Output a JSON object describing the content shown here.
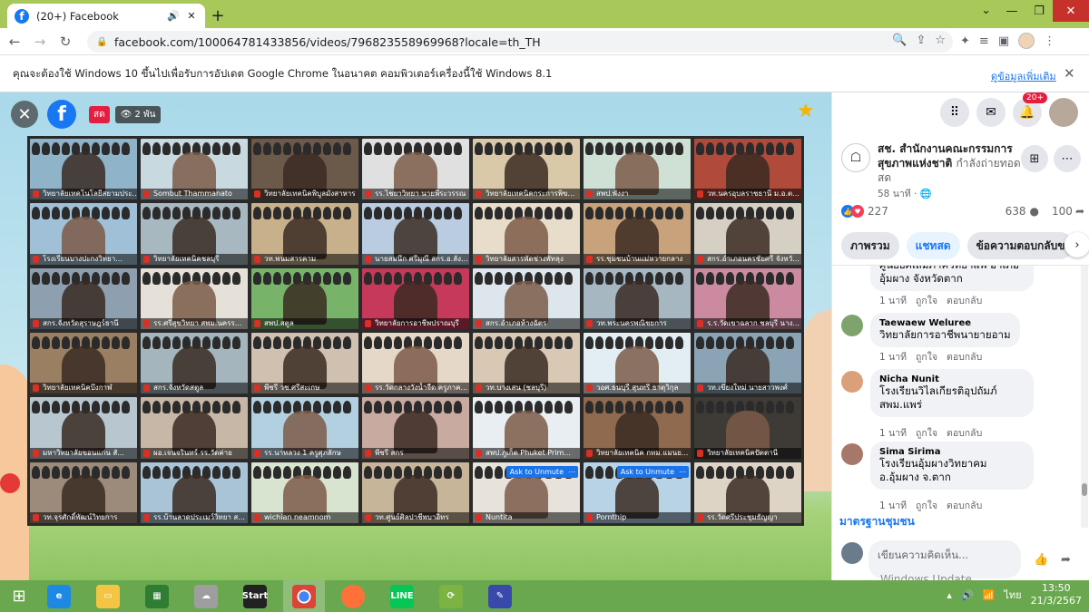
{
  "browser": {
    "tab_title": "(20+) Facebook",
    "url": "facebook.com/100064781433856/videos/796823558969968?locale=th_TH",
    "infobar_message": "คุณจะต้องใช้ Windows 10 ขึ้นไปเพื่อรับการอัปเดต Google Chrome ในอนาคต คอมพิวเตอร์เครื่องนี้ใช้ Windows 8.1",
    "infobar_link": "ดูข้อมูลเพิ่มเติม"
  },
  "video": {
    "live_label": "สด",
    "viewers": "2 พัน",
    "participants": [
      {
        "name": "วิทยาลัยเทคโนโลยีสยามประ...",
        "color": "#8fb3c9",
        "light": false
      },
      {
        "name": "Sombut Thammanato",
        "color": "#c9d9e0",
        "light": true
      },
      {
        "name": "วิทยาลัยเทคนิคพิบูลมังสาหาร",
        "color": "#6b5a4a",
        "light": false
      },
      {
        "name": "รร.ไชยาวิทยา นายพีระวรรณ",
        "color": "#e0e0e0",
        "light": true
      },
      {
        "name": "วิทยาลัยเทคนิคกระการพิข...",
        "color": "#d9c9a8",
        "light": false
      },
      {
        "name": "สพป.พังงา",
        "color": "#cfe0d4",
        "light": true
      },
      {
        "name": "วท.นครอุบลราชธานี ม.อ.ต...",
        "color": "#b04a3a",
        "light": false
      },
      {
        "name": "โรงเรียนบางปะกงวิทยา...",
        "color": "#9fc0d6",
        "light": true
      },
      {
        "name": "วิทยาลัยเทคนิคชลบุรี",
        "color": "#a8b8c0",
        "light": false
      },
      {
        "name": "วท.พนมสารคาม",
        "color": "#c8b08a",
        "light": false
      },
      {
        "name": "นายสมนึก ศรีมุณี สกร.อ.ลัง...",
        "color": "#b9cce0",
        "light": false
      },
      {
        "name": "วิทยาลัยสารพัดช่างพัทลุง",
        "color": "#e8dccb",
        "light": true
      },
      {
        "name": "รร.ชุมชนบ้านแม่หวายกลาง",
        "color": "#c7a27a",
        "light": false
      },
      {
        "name": "สกร.อำเภอนครชัยศรี จังหวั...",
        "color": "#d6d0c4",
        "light": false
      },
      {
        "name": "สกร.จังหวัดสุราษฎร์ธานี",
        "color": "#8e9fb0",
        "light": false
      },
      {
        "name": "รร.ศรีสุขวิทยา สพม.นครร...",
        "color": "#e5e0d8",
        "light": true
      },
      {
        "name": "สพป.สตูล",
        "color": "#78b36a",
        "light": false
      },
      {
        "name": "วิทยาลัยการอาชีพปราณบุรี",
        "color": "#c7395a",
        "light": false
      },
      {
        "name": "สกร.อำเภอห้างฉัตร",
        "color": "#dce6ec",
        "light": true
      },
      {
        "name": "วท.พระนครพณิชยการ",
        "color": "#a7b7c2",
        "light": false
      },
      {
        "name": "ร.ร.วัดเขาฉลาก ชลบุรี นาง...",
        "color": "#cc8aa0",
        "light": false
      },
      {
        "name": "วิทยาลัยเทคนิคบึงกาฬ",
        "color": "#9a7f63",
        "light": false
      },
      {
        "name": "สกร.จังหวัดสตูล",
        "color": "#a4b5bd",
        "light": false
      },
      {
        "name": "พีชรี วช.ศรีสะเกษ",
        "color": "#d0c0b0",
        "light": false
      },
      {
        "name": "รร.วัดกลางวังน้ำจืด ครูภาค...",
        "color": "#e6d8c9",
        "light": true
      },
      {
        "name": "วท.บางเสน (ชลบุรี)",
        "color": "#d8c8b4",
        "light": false
      },
      {
        "name": "วอศ.ธนบุรี สุนทรี ธาตุวิกุล",
        "color": "#e3eef4",
        "light": true
      },
      {
        "name": "วท.เขียงใหม่ นายสาวพงศ์",
        "color": "#8aa4b6",
        "light": false
      },
      {
        "name": "มหาวิทยาลัยขอนแก่น สั...",
        "color": "#b7c6cf",
        "light": false
      },
      {
        "name": "ผอ.เจนจรินทร์ รร.วัดค่าย",
        "color": "#c6b7a6",
        "light": false
      },
      {
        "name": "รร.นาหลวง 1 ครูศุภลักษ",
        "color": "#b3d0e0",
        "light": true
      },
      {
        "name": "พีชรี สกร",
        "color": "#c8aaa0",
        "light": false
      },
      {
        "name": "สพป.ภูเก็ต Phuket Prim...",
        "color": "#e9eef2",
        "light": true
      },
      {
        "name": "วิทยาลัยเทคนิค กทม.แมนย...",
        "color": "#8f6a4f",
        "light": false
      },
      {
        "name": "วิทยาลัยเทคนิคปัตตานี",
        "color": "#3e3a36",
        "light": true
      },
      {
        "name": "วท.จุรศักดิ์พัฒน์วิทยการ",
        "color": "#9c8a7a",
        "light": false
      },
      {
        "name": "รร.บ้านลาดประเมว์วิทยา ส...",
        "color": "#a8c4d6",
        "light": false
      },
      {
        "name": "wichian neamnom",
        "color": "#d9e4d0",
        "light": true
      },
      {
        "name": "วท.ศูนย์ศิลปาชีพบาอิทร",
        "color": "#c7b59a",
        "light": false
      },
      {
        "name": "Nuntita",
        "color": "#e7e2da",
        "light": true
      },
      {
        "name": "Pornthip",
        "color": "#b9d3e6",
        "light": false
      },
      {
        "name": "รร.วัดศรีประชุมธัญญา",
        "color": "#ded4c6",
        "light": false
      }
    ],
    "unmute_label": "Ask to Unmute",
    "more_label": "⋯"
  },
  "sidebar": {
    "notif_count": "20+",
    "page_name": "สช. สำนักงานคณะกรรมการสุขภาพแห่งชาติ",
    "page_status": "กำลังถ่ายทอดสด",
    "time_ago": "58 นาที ·",
    "reactions": "227",
    "comments_count": "638",
    "shares_count": "100",
    "tabs": [
      "ภาพรวม",
      "แชทสด",
      "ข้อความตอบกลับข"
    ],
    "comments": [
      {
        "name": "",
        "text": "ศูนย์ยศเสมภาควิทยาแพ อำเภออุ้มผาง จังหวัดตาก",
        "time": "1 นาที"
      },
      {
        "name": "Taewaew Weluree",
        "text": "วิทยาลัยการอาชีพนายายอาม",
        "time": "1 นาที"
      },
      {
        "name": "Nicha Nunit",
        "text": "โรงเรียนวิไลเกียรติอุปถัมภ์ สพม.แพร่",
        "time": "1 นาที"
      },
      {
        "name": "Sima Sirima",
        "text": "โรงเรียนอุ้มผางวิทยาคม อ.อุ้มผาง จ.ตาก",
        "time": "1 นาที"
      }
    ],
    "like_label": "ถูกใจ",
    "reply_label": "ตอบกลับ",
    "standard_link": "มาตรฐานชุมชน",
    "compose_placeholder": "เขียนความคิดเห็น..."
  },
  "os": {
    "watermark": "Windows Update",
    "start_label": "Start",
    "lang": "ไทย",
    "time": "13:50",
    "date": "21/3/2567"
  }
}
